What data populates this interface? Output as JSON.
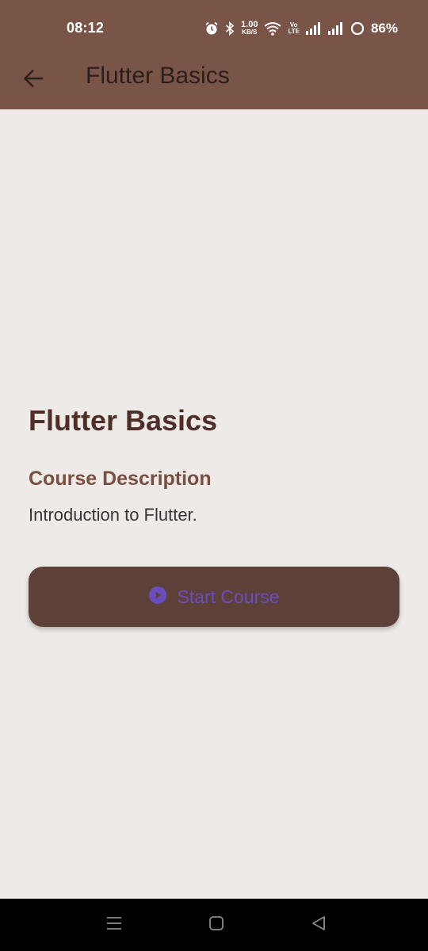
{
  "status_bar": {
    "time": "08:12",
    "net_speed_value": "1.00",
    "net_speed_unit": "KB/S",
    "volte_top": "Vo",
    "volte_bottom": "LTE",
    "battery_percent": "86%"
  },
  "app_bar": {
    "title": "Flutter Basics",
    "background_color": "#795548"
  },
  "course": {
    "title": "Flutter Basics",
    "section_heading": "Course Description",
    "description": "Introduction to Flutter."
  },
  "start_button": {
    "label": "Start Course",
    "icon": "play-circle-icon",
    "background_color": "#5d4037",
    "label_color": "#6a4ec0"
  },
  "nav_bar": {
    "icons": [
      "menu-icon",
      "home-square-icon",
      "back-triangle-icon"
    ]
  }
}
